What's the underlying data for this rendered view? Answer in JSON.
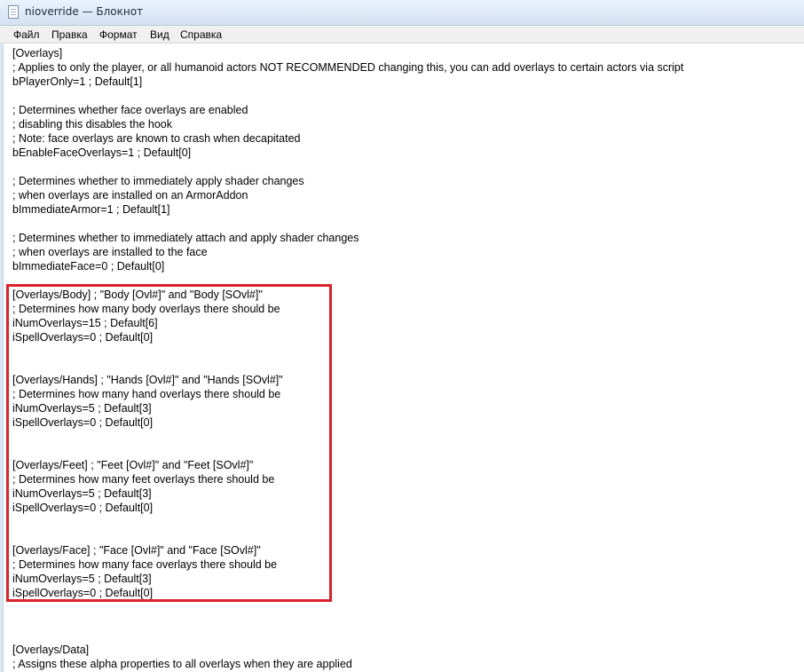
{
  "window": {
    "title": "nioverride — Блокнот",
    "icon": "notepad-icon"
  },
  "menu": [
    "Файл",
    "Правка",
    "Формат",
    "Вид",
    "Справка"
  ],
  "colors": {
    "highlight": "#d8232a",
    "titlebar": "#dce7f5"
  },
  "lines": [
    "[Overlays]",
    "; Applies to only the player, or all humanoid actors NOT RECOMMENDED changing this, you can add overlays to certain actors via script",
    "bPlayerOnly=1 ; Default[1]",
    "",
    "; Determines whether face overlays are enabled",
    "; disabling this disables the hook",
    "; Note: face overlays are known to crash when decapitated",
    "bEnableFaceOverlays=1 ; Default[0]",
    "",
    "; Determines whether to immediately apply shader changes",
    "; when overlays are installed on an ArmorAddon",
    "bImmediateArmor=1 ; Default[1]",
    "",
    "; Determines whether to immediately attach and apply shader changes",
    "; when overlays are installed to the face",
    "bImmediateFace=0 ; Default[0]",
    "",
    "[Overlays/Body] ; \"Body [Ovl#]\" and \"Body [SOvl#]\"",
    "; Determines how many body overlays there should be",
    "iNumOverlays=15 ; Default[6]",
    "iSpellOverlays=0 ; Default[0]",
    "",
    "",
    "[Overlays/Hands] ; \"Hands [Ovl#]\" and \"Hands [SOvl#]\"",
    "; Determines how many hand overlays there should be",
    "iNumOverlays=5 ; Default[3]",
    "iSpellOverlays=0 ; Default[0]",
    "",
    "",
    "[Overlays/Feet] ; \"Feet [Ovl#]\" and \"Feet [SOvl#]\"",
    "; Determines how many feet overlays there should be",
    "iNumOverlays=5 ; Default[3]",
    "iSpellOverlays=0 ; Default[0]",
    "",
    "",
    "[Overlays/Face] ; \"Face [Ovl#]\" and \"Face [SOvl#]\"",
    "; Determines how many face overlays there should be",
    "iNumOverlays=5 ; Default[3]",
    "iSpellOverlays=0 ; Default[0]",
    "",
    "",
    "",
    "[Overlays/Data]",
    "; Assigns these alpha properties to all overlays when they are applied"
  ]
}
